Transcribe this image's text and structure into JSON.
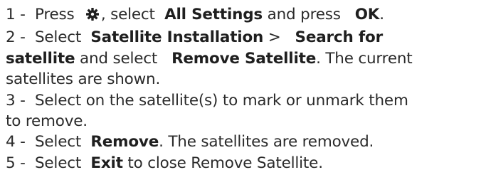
{
  "steps": [
    {
      "num": "1 -",
      "p1": "Press",
      "icon": "gear-icon",
      "p2": ", select",
      "b1": "All Settings",
      "p3": "and press",
      "b2": "OK",
      "p4": "."
    },
    {
      "num": "2 -",
      "p1": "Select",
      "b1": "Satellite Installation",
      "p2": ">",
      "b2": "Search for",
      "b3": "satellite",
      "p3": "and select",
      "b4": "Remove Satellite",
      "p4": ". The current",
      "p5": "satellites are shown."
    },
    {
      "num": "3 -",
      "p1": "Select on the satellite(s) to mark or unmark them",
      "p2": "to remove."
    },
    {
      "num": "4 -",
      "p1": "Select",
      "b1": "Remove",
      "p2": ". The satellites are removed."
    },
    {
      "num": "5 -",
      "p1": "Select",
      "b1": "Exit",
      "p2": "to close Remove Satellite."
    }
  ]
}
